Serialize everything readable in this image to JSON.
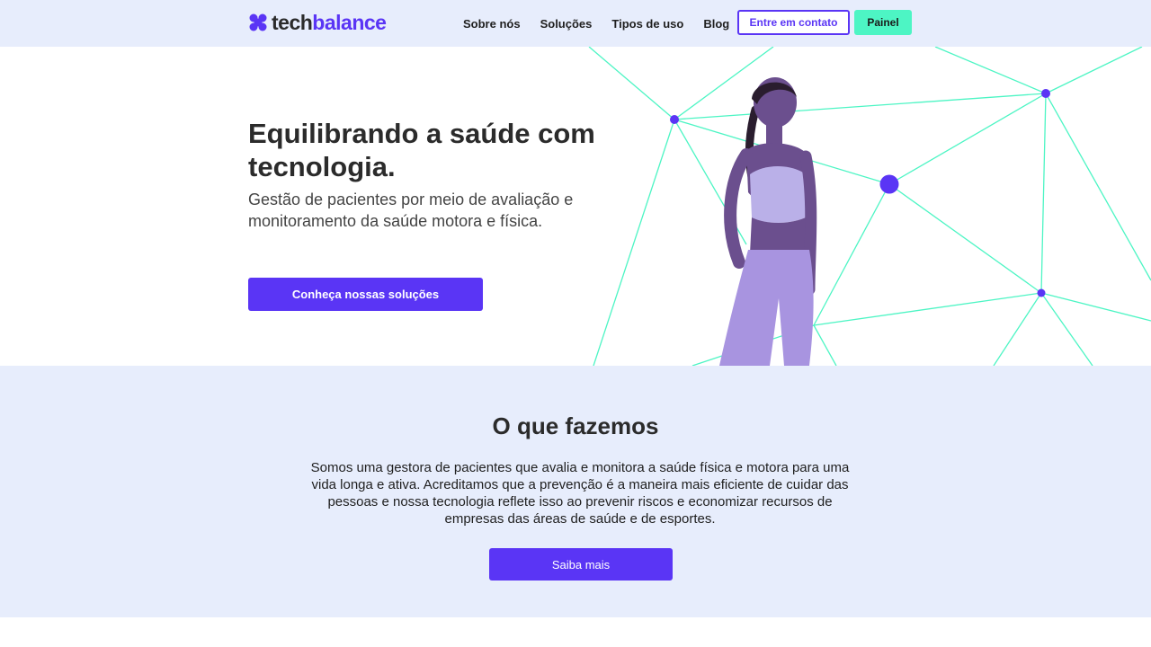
{
  "brand": {
    "name_part1": "tech",
    "name_part2": "balance",
    "accent": "#5a35f5",
    "accent_secondary": "#4df5c4",
    "background_tint": "#e7edfc"
  },
  "nav": {
    "items": [
      {
        "label": "Sobre nós"
      },
      {
        "label": "Soluções"
      },
      {
        "label": "Tipos de uso"
      },
      {
        "label": "Blog"
      }
    ],
    "contact_label": "Entre em contato",
    "panel_label": "Painel"
  },
  "hero": {
    "title": "Equilibrando a saúde com tecnologia.",
    "subtitle": "Gestão de pacientes por meio de avaliação e monitoramento da saúde motora e física.",
    "cta_label": "Conheça nossas soluções"
  },
  "about": {
    "title": "O que fazemos",
    "text": "Somos uma gestora de pacientes que avalia e monitora a saúde física e motora para uma vida longa e ativa. Acreditamos que a prevenção é a maneira mais eficiente de cuidar das pessoas e nossa tecnologia reflete isso ao prevenir riscos e economizar recursos de empresas das áreas de saúde e de esportes.",
    "cta_label": "Saiba mais"
  },
  "icons": {
    "logo": "techbalance-logo-icon",
    "network": "network-graph-decoration",
    "person": "athlete-woman-image"
  }
}
